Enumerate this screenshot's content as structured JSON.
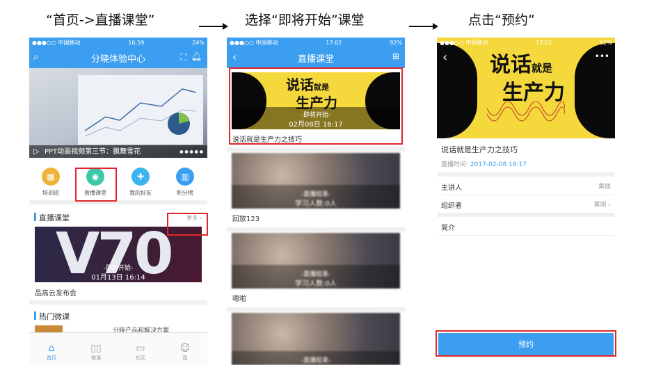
{
  "steps": {
    "step1": "“首页->直播课堂”",
    "step2": "选择“即将开始”课堂",
    "step3": "点击“预约”"
  },
  "phone1": {
    "status": {
      "carrier": "●●●○○ 中国移动",
      "time": "16:59",
      "battery": "24%"
    },
    "title": "分晓体验中心",
    "banner_caption": "PPT动画视频第三节：飘舞雪花",
    "grid": [
      {
        "label": "培训班",
        "icon": "training-icon",
        "color": "#f0b43c"
      },
      {
        "label": "直播课堂",
        "icon": "live-icon",
        "color": "#3cc8a8"
      },
      {
        "label": "我的好友",
        "icon": "friends-icon",
        "color": "#3cb4f0"
      },
      {
        "label": "积分榜",
        "icon": "ranking-icon",
        "color": "#3c9ef0"
      }
    ],
    "live_section": {
      "title": "直播课堂",
      "more": "更多"
    },
    "live_card": {
      "big_text": "V70",
      "status": "-即将开始-",
      "time": "01月13日 16:14",
      "caption": "品高云发布会"
    },
    "hot_section": {
      "title": "热门微课",
      "item": "分晓产品和解决方案"
    },
    "tabs": [
      {
        "label": "首页",
        "icon": "home-icon"
      },
      {
        "label": "微课",
        "icon": "book-icon"
      },
      {
        "label": "社区",
        "icon": "community-icon"
      },
      {
        "label": "我",
        "icon": "person-icon"
      }
    ]
  },
  "phone2": {
    "status": {
      "carrier": "●●●○○ 中国移动",
      "time": "17:02",
      "battery": "92%"
    },
    "title": "直播课堂",
    "cards": [
      {
        "poster_line1": "说话",
        "poster_small": "就是",
        "poster_line2": "生产力",
        "status": "-即将开始-",
        "time": "02月08日 16:17",
        "caption": "说话就是生产力之技巧"
      },
      {
        "status": "-直播结束-",
        "viewers": "学习人数:0人",
        "caption": "回放123"
      },
      {
        "status": "-直播结束-",
        "viewers": "学习人数:0人",
        "caption": "嗯啦"
      },
      {
        "status": "-直播结束-",
        "viewers": ""
      }
    ]
  },
  "phone3": {
    "status": {
      "carrier": "●●●○○ 中国移动",
      "time": "17:02",
      "battery": "92%"
    },
    "poster": {
      "line1": "说话",
      "small": "就是",
      "line2": "生产力"
    },
    "course_title": "说话就是生产力之技巧",
    "time_label": "直播时间:",
    "time_value": "2017-02-08 16:17",
    "rows": [
      {
        "label": "主讲人",
        "value": "黄丽"
      },
      {
        "label": "组织者",
        "value": "黄丽"
      },
      {
        "label": "简介",
        "value": ""
      }
    ],
    "reserve_button": "预约"
  },
  "colors": {
    "accent": "#3c9ef0",
    "highlight": "#e0262b",
    "poster_yellow": "#f5d83c"
  }
}
